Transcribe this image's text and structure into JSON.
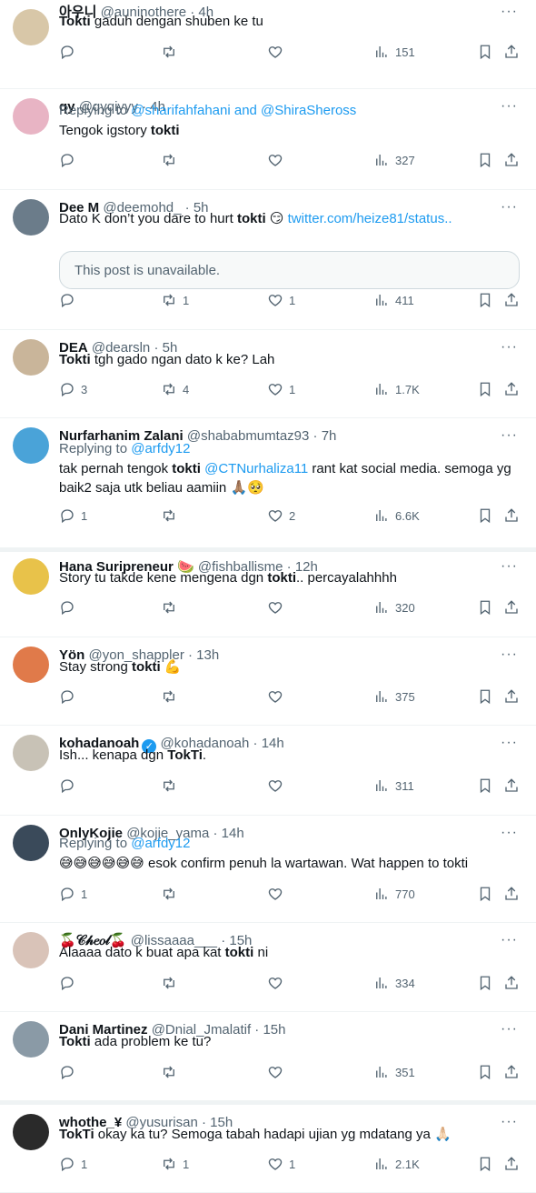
{
  "tweets": [
    {
      "name": "아우니",
      "handle": "@auninothere",
      "time": "4h",
      "replying": "",
      "segments": [
        {
          "t": "Tokti",
          "b": true
        },
        {
          "t": " gaduh dengan shuben ke tu",
          "b": false
        }
      ],
      "line2": "",
      "card": "",
      "replies": "",
      "retweets": "",
      "likes": "",
      "views": "151",
      "avatar_color": "#d8c7a8"
    },
    {
      "name": "qy",
      "handle": "@qyqiyyy",
      "time": "4h",
      "replying": "@sharifahfahani and @ShiraSheross",
      "segments": [
        {
          "t": "Tengok igstory ",
          "b": false
        },
        {
          "t": "tokti",
          "b": true
        }
      ],
      "line2": "",
      "card": "",
      "replies": "",
      "retweets": "",
      "likes": "",
      "views": "327",
      "avatar_color": "#e8b4c4"
    },
    {
      "name": "Dee M",
      "handle": "@deemohd_",
      "time": "5h",
      "replying": "",
      "segments": [
        {
          "t": "Dato K don’t you dare to hurt ",
          "b": false
        },
        {
          "t": "tokti",
          "b": true
        },
        {
          "t": " 😏 ",
          "b": false
        },
        {
          "t": "twitter.com/heize81/status..",
          "link": true
        }
      ],
      "line2": "",
      "card": "This post is unavailable.",
      "replies": "",
      "retweets": "1",
      "likes": "1",
      "views": "411",
      "avatar_color": "#6b7c8a"
    },
    {
      "name": "DEA",
      "handle": "@dearsln",
      "time": "5h",
      "replying": "",
      "segments": [
        {
          "t": "Tokti",
          "b": true
        },
        {
          "t": " tgh gado ngan dato k ke? Lah",
          "b": false
        }
      ],
      "line2": "",
      "card": "",
      "replies": "3",
      "retweets": "4",
      "likes": "1",
      "views": "1.7K",
      "avatar_color": "#c9b59a"
    },
    {
      "name": "Nurfarhanim Zalani",
      "handle": "@shababmumtaz93",
      "time": "7h",
      "replying": "@arfdy12",
      "segments": [
        {
          "t": "tak pernah tengok ",
          "b": false
        },
        {
          "t": "tokti",
          "b": true
        },
        {
          "t": " ",
          "b": false
        },
        {
          "t": "@CTNurhaliza11",
          "link": true
        },
        {
          "t": " rant kat social media. semoga yg",
          "b": false
        }
      ],
      "line2": "baik2 saja utk beliau aamiin 🙏🏽🥺",
      "card": "",
      "replies": "1",
      "retweets": "",
      "likes": "2",
      "views": "6.6K",
      "avatar_color": "#4aa3d8"
    },
    {
      "name": "Hana Suripreneur 🍉",
      "handle": "@fishballisme",
      "time": "12h",
      "replying": "",
      "segments": [
        {
          "t": "Story tu takde kene mengena dgn ",
          "b": false
        },
        {
          "t": "tokti",
          "b": true
        },
        {
          "t": ".. percayalahhhh",
          "b": false
        }
      ],
      "line2": "",
      "card": "",
      "replies": "",
      "retweets": "",
      "likes": "",
      "views": "320",
      "avatar_color": "#e8c24a"
    },
    {
      "name": "Yön",
      "handle": "@yon_shappler",
      "time": "13h",
      "replying": "",
      "segments": [
        {
          "t": "Stay strong ",
          "b": false
        },
        {
          "t": "tokti",
          "b": true
        },
        {
          "t": " 💪",
          "b": false
        }
      ],
      "line2": "",
      "card": "",
      "replies": "",
      "retweets": "",
      "likes": "",
      "views": "375",
      "avatar_color": "#e07a4a"
    },
    {
      "name": "kohadanoah",
      "handle": "@kohadanoah",
      "time": "14h",
      "replying": "",
      "segments": [
        {
          "t": "Ish... kenapa dgn ",
          "b": false
        },
        {
          "t": "TokTi",
          "b": true
        },
        {
          "t": ".",
          "b": false
        }
      ],
      "line2": "",
      "card": "",
      "replies": "",
      "retweets": "",
      "likes": "",
      "views": "311",
      "avatar_color": "#c8c2b6"
    },
    {
      "name": "OnlyKojie",
      "handle": "@kojie_yama",
      "time": "14h",
      "replying": "@arfdy12",
      "segments": [
        {
          "t": "😅😅😅😅😅😅 esok confirm penuh la wartawan. Wat happen to tokti",
          "b": false
        }
      ],
      "line2": "",
      "card": "",
      "replies": "1",
      "retweets": "",
      "likes": "",
      "views": "770",
      "avatar_color": "#3a4a5a"
    },
    {
      "name": "🍒𝒞𝒽𝑒𝑜𝓁🍒",
      "handle": "@lissaaaa___",
      "time": "15h",
      "replying": "",
      "segments": [
        {
          "t": "Alaaaa dato k buat apa kat ",
          "b": false
        },
        {
          "t": "tokti",
          "b": true
        },
        {
          "t": " ni",
          "b": false
        }
      ],
      "line2": "",
      "card": "",
      "replies": "",
      "retweets": "",
      "likes": "",
      "views": "334",
      "avatar_color": "#d9c3b8"
    },
    {
      "name": "Dani Martinez",
      "handle": "@Dnial_Jmalatif",
      "time": "15h",
      "replying": "",
      "segments": [
        {
          "t": "Tokti",
          "b": true
        },
        {
          "t": " ada problem ke tu?",
          "b": false
        }
      ],
      "line2": "",
      "card": "",
      "replies": "",
      "retweets": "",
      "likes": "",
      "views": "351",
      "avatar_color": "#8a9aa6"
    },
    {
      "name": "whothe_¥",
      "handle": "@yusurisan",
      "time": "15h",
      "replying": "",
      "segments": [
        {
          "t": "TokTi",
          "b": true
        },
        {
          "t": " okay ka tu? Semoga tabah hadapi ujian yg mdatang ya 🙏🏻",
          "b": false
        }
      ],
      "line2": "",
      "card": "",
      "replies": "1",
      "retweets": "1",
      "likes": "1",
      "views": "2.1K",
      "avatar_color": "#2a2a2a"
    }
  ],
  "replying_prefix": "Replying to ",
  "icons": {
    "reply": "reply-icon",
    "retweet": "retweet-icon",
    "like": "heart-icon",
    "views": "views-icon",
    "bookmark": "bookmark-icon",
    "share": "share-icon",
    "more": "more-icon"
  }
}
